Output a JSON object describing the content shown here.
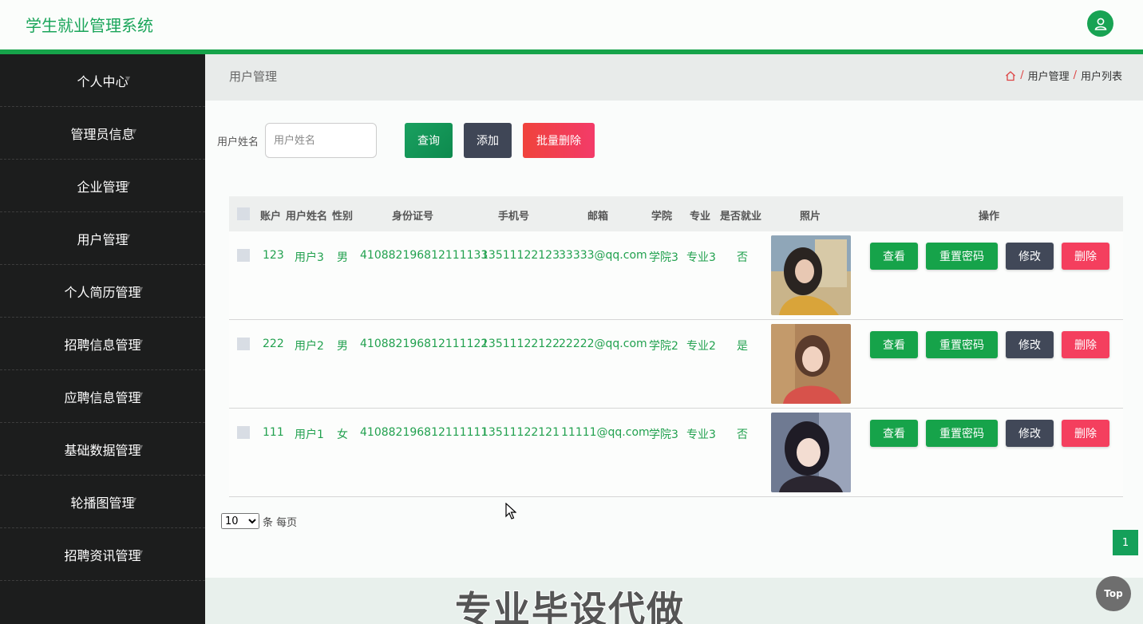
{
  "app": {
    "title": "学生就业管理系统"
  },
  "sidebar": {
    "items": [
      {
        "label": "个人中心"
      },
      {
        "label": "管理员信息"
      },
      {
        "label": "企业管理"
      },
      {
        "label": "用户管理"
      },
      {
        "label": "个人简历管理"
      },
      {
        "label": "招聘信息管理"
      },
      {
        "label": "应聘信息管理"
      },
      {
        "label": "基础数据管理"
      },
      {
        "label": "轮播图管理"
      },
      {
        "label": "招聘资讯管理"
      }
    ]
  },
  "page": {
    "title": "用户管理"
  },
  "breadcrumb": {
    "items": [
      "用户管理",
      "用户列表"
    ],
    "separator": "/"
  },
  "search": {
    "label": "用户姓名",
    "placeholder": "用户姓名",
    "value": ""
  },
  "toolbar": {
    "query_label": "查询",
    "add_label": "添加",
    "batch_delete_label": "批量删除"
  },
  "table": {
    "columns": [
      "账户",
      "用户姓名",
      "性别",
      "身份证号",
      "手机号",
      "邮箱",
      "学院",
      "专业",
      "是否就业",
      "照片",
      "操作"
    ],
    "rows": [
      {
        "account": "123",
        "name": "用户3",
        "gender": "男",
        "id_number": "410882196812111133",
        "phone": "13511122123",
        "email": "33333@qq.com",
        "college": "学院3",
        "major": "专业3",
        "employed": "否"
      },
      {
        "account": "222",
        "name": "用户2",
        "gender": "男",
        "id_number": "410882196812111122",
        "phone": "13511122122",
        "email": "22222@qq.com",
        "college": "学院2",
        "major": "专业2",
        "employed": "是"
      },
      {
        "account": "111",
        "name": "用户1",
        "gender": "女",
        "id_number": "410882196812111111",
        "phone": "13511122121",
        "email": "11111@qq.com",
        "college": "学院3",
        "major": "专业3",
        "employed": "否"
      }
    ],
    "actions": {
      "view": "查看",
      "reset": "重置密码",
      "edit": "修改",
      "delete": "删除"
    }
  },
  "pagination": {
    "page_size": "10",
    "page_size_suffix": "条 每页",
    "current_page": "1"
  },
  "watermark": "专业毕设代做",
  "back_to_top": "Top",
  "colors": {
    "accent": "#16a34a",
    "danger": "#f43f5e",
    "dark_button": "#414858",
    "sidebar_bg": "#1c1d1d"
  }
}
